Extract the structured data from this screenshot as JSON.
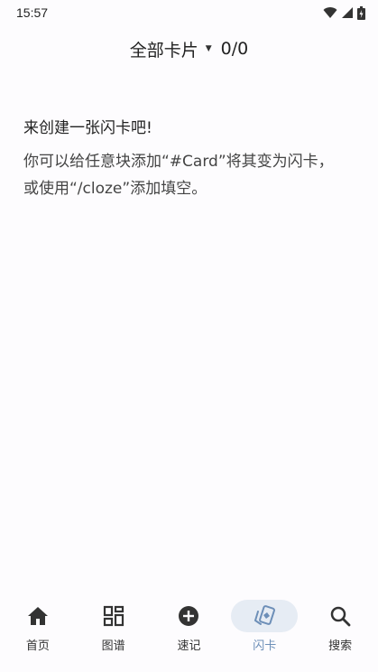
{
  "status_bar": {
    "time": "15:57"
  },
  "header": {
    "deck_label": "全部卡片",
    "count": "0/0"
  },
  "empty_state": {
    "title": "来创建一张闪卡吧!",
    "description_line1": "你可以给任意块添加“#Card”将其变为闪卡，",
    "description_line2": "或使用“/cloze”添加填空。"
  },
  "bottom_nav": {
    "items": [
      {
        "label": "首页",
        "icon": "home-icon"
      },
      {
        "label": "图谱",
        "icon": "graph-icon"
      },
      {
        "label": "速记",
        "icon": "plus-circle-icon"
      },
      {
        "label": "闪卡",
        "icon": "flashcard-icon",
        "active": true
      },
      {
        "label": "搜索",
        "icon": "search-icon"
      }
    ]
  },
  "colors": {
    "accent": "#6d8fb8",
    "active_pill": "#e6ecf4",
    "background": "#fdfcfe"
  }
}
